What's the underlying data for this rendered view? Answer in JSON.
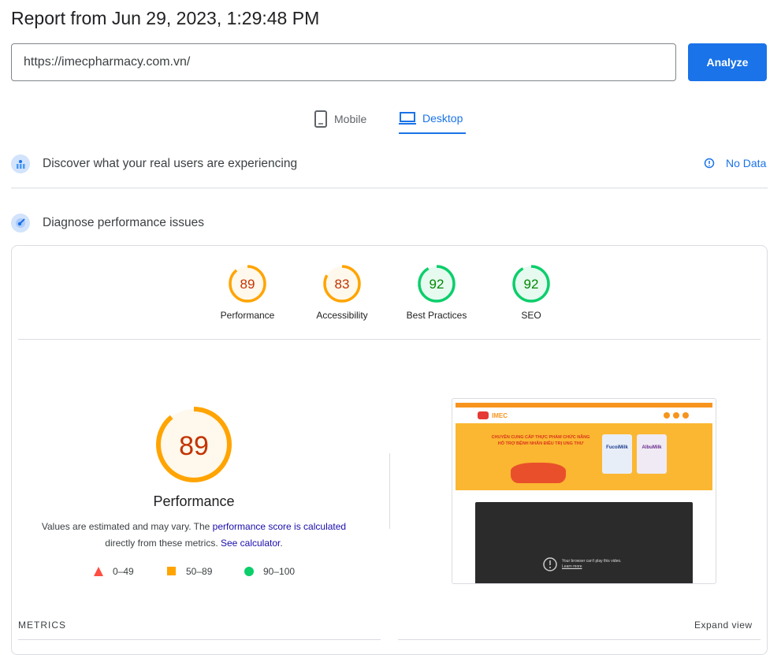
{
  "header": {
    "title": "Report from Jun 29, 2023, 1:29:48 PM"
  },
  "search": {
    "url": "https://imecpharmacy.com.vn/",
    "analyze_label": "Analyze"
  },
  "tabs": [
    {
      "label": "Mobile",
      "icon": "phone-icon",
      "active": false
    },
    {
      "label": "Desktop",
      "icon": "laptop-icon",
      "active": true
    }
  ],
  "field_data": {
    "title": "Discover what your real users are experiencing",
    "status": "No Data"
  },
  "lab": {
    "title": "Diagnose performance issues"
  },
  "scores": [
    {
      "label": "Performance",
      "value": "89",
      "color": "#ffa400"
    },
    {
      "label": "Accessibility",
      "value": "83",
      "color": "#ffa400"
    },
    {
      "label": "Best Practices",
      "value": "92",
      "color": "#0cce6b"
    },
    {
      "label": "SEO",
      "value": "92",
      "color": "#0cce6b"
    }
  ],
  "main_score": {
    "value": "89",
    "label": "Performance",
    "desc_prefix": "Values are estimated and may vary. The ",
    "link1": "performance score is calculated",
    "desc_mid": " directly from these metrics. ",
    "link2": "See calculator",
    "desc_suffix": "."
  },
  "legend": [
    {
      "range": "0–49",
      "color": "#ff4e42",
      "shape": "triangle"
    },
    {
      "range": "50–89",
      "color": "#ffa400",
      "shape": "square"
    },
    {
      "range": "90–100",
      "color": "#0cce6b",
      "shape": "circle"
    }
  ],
  "screenshot": {
    "brand": "IMEC",
    "headline1": "CHUYÊN CUNG CẤP THỰC PHẨM CHỨC NĂNG",
    "headline2": "HỖ TRỢ BỆNH NHÂN ĐIỀU TRỊ UNG THƯ",
    "product1": "FucoiMilk",
    "product2": "AlbuMilk",
    "video_msg": "Your browser can't play this video.",
    "video_link": "Learn more"
  },
  "metrics": {
    "label": "METRICS",
    "expand": "Expand view"
  }
}
